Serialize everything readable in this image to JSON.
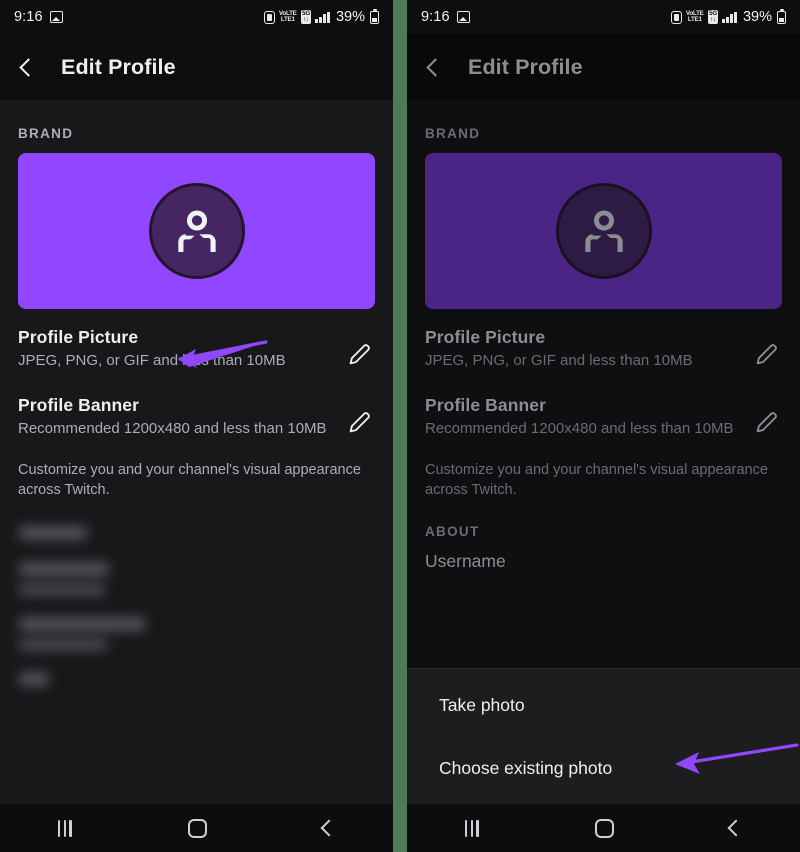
{
  "meta": {
    "colors": {
      "twitch_purple": "#9147ff",
      "twitch_purple_dim": "#4b2585",
      "background": "#18181b",
      "appbar": "#0e0e10",
      "text_primary": "#efeff1",
      "text_secondary": "#adadb8",
      "sheet": "#1d1d20",
      "divider_green": "#4e7a58",
      "annotation_arrow": "#9147ff"
    }
  },
  "status_bar": {
    "time": "9:16",
    "battery_percent": "39%",
    "icons": {
      "screenshot": "image-icon",
      "alarm": "alarm-icon",
      "volte": "VoLTE",
      "volte_line1": "VoLTE",
      "volte_line2": "LTE1",
      "network_badge_line1": "5G",
      "network_badge_line2": "↑↓",
      "signal": "signal-bars-icon",
      "battery": "battery-icon"
    }
  },
  "app_bar": {
    "back_icon": "back-chevron-icon",
    "title": "Edit Profile"
  },
  "brand": {
    "section_label": "BRAND",
    "avatar_icon": "person-avatar-icon",
    "rows": [
      {
        "title": "Profile Picture",
        "subtitle": "JPEG, PNG, or GIF and less than 10MB",
        "edit_icon": "pencil-icon"
      },
      {
        "title": "Profile Banner",
        "subtitle": "Recommended 1200x480 and less than 10MB",
        "edit_icon": "pencil-icon"
      }
    ],
    "description": "Customize you and your channel's visual appearance across Twitch."
  },
  "about": {
    "section_label": "ABOUT",
    "username_label": "Username"
  },
  "bottom_sheet": {
    "items": [
      {
        "label": "Take photo"
      },
      {
        "label": "Choose existing photo"
      }
    ]
  },
  "nav_bar": {
    "recents_icon": "recents-icon",
    "home_icon": "home-icon",
    "back_icon": "back-icon"
  },
  "annotations": [
    {
      "target": "Profile Picture",
      "type": "arrow-pointing-left"
    },
    {
      "target": "Choose existing photo",
      "type": "arrow-pointing-left"
    }
  ]
}
